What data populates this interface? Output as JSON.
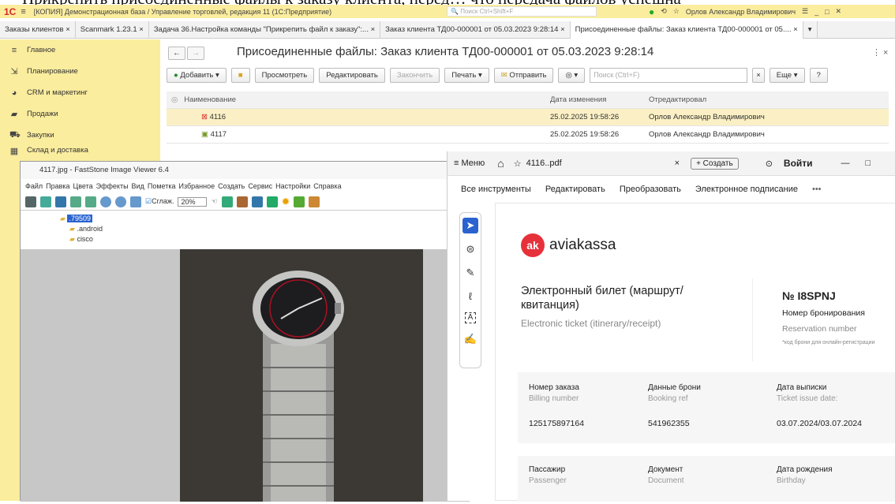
{
  "ghost_text": "Прикрепить присоединенные файлы к заказу клиента, перед… что передача файлов успешна",
  "titlebar": {
    "logo": "1С",
    "title": "[КОПИЯ] Демонстрационная база / Управление торговлей, редакция 11  (1С:Предприятие)",
    "search_placeholder": "Поиск Ctrl+Shift+F",
    "user": "Орлов Александр Владимирович"
  },
  "tabs": [
    {
      "label": "Заказы клиентов ×"
    },
    {
      "label": "Scanmark 1.23.1 ×"
    },
    {
      "label": "Задача 36.Настройка команды \"Прикрепить файл к заказу\":... ×"
    },
    {
      "label": "Заказ клиента ТД00-000001 от 05.03.2023 9:28:14 ×"
    },
    {
      "label": "Присоединенные файлы: Заказ клиента ТД00-000001 от 05.... ×"
    }
  ],
  "sidebar": {
    "items": [
      {
        "label": "Главное",
        "icon": "menu-icon"
      },
      {
        "label": "Планирование",
        "icon": "chart-icon"
      },
      {
        "label": "CRM и маркетинг",
        "icon": "pie-icon"
      },
      {
        "label": "Продажи",
        "icon": "bag-icon"
      },
      {
        "label": "Закупки",
        "icon": "cart-icon"
      },
      {
        "label": "Склад и доставка",
        "icon": "grid-icon"
      }
    ]
  },
  "main": {
    "title": "Присоединенные файлы: Заказ клиента ТД00-000001 от 05.03.2023 9:28:14",
    "toolbar": {
      "add": "Добавить",
      "view": "Просмотреть",
      "edit": "Редактировать",
      "finish": "Закончить",
      "print": "Печать",
      "send": "Отправить",
      "search_placeholder": "Поиск (Ctrl+F)",
      "more": "Еще",
      "help": "?"
    },
    "columns": [
      "Наименование",
      "Дата изменения",
      "Отредактировал"
    ],
    "rows": [
      {
        "name": "4116",
        "date": "25.02.2025 19:58:26",
        "editor": "Орлов Александр Владимирович"
      },
      {
        "name": "4117",
        "date": "25.02.2025 19:58:26",
        "editor": "Орлов Александр Владимирович"
      }
    ]
  },
  "faststone": {
    "title": "4117.jpg  -  FastStone Image Viewer 6.4",
    "menu": [
      "Файл",
      "Правка",
      "Цвета",
      "Эффекты",
      "Вид",
      "Пометка",
      "Избранное",
      "Создать",
      "Сервис",
      "Настройки",
      "Справка"
    ],
    "smooth_label": "Сглаж.",
    "zoom": "20%",
    "tree": [
      ".79509",
      ".android",
      "cisco"
    ]
  },
  "pdf": {
    "menu_label": "Меню",
    "tab_title": "4116..pdf",
    "create_label": "+ Создать",
    "login_label": "Войти",
    "tools": [
      "Все инструменты",
      "Редактировать",
      "Преобразовать",
      "Электронное подписание",
      "•••"
    ],
    "doc": {
      "brand": "aviakassa",
      "heading_ru": "Электронный билет (маршрут/ квитанция)",
      "heading_en": "Electronic ticket (itinerary/receipt)",
      "booking_no": "№ I8SPNJ",
      "booking_ru": "Номер бронирования",
      "booking_en": "Reservation number",
      "booking_note": "*код брони для онлайн-регистрации",
      "card1": [
        {
          "label": "Номер заказа",
          "sub": "Billing number",
          "value": "125175897164"
        },
        {
          "label": "Данные брони",
          "sub": "Booking ref",
          "value": "541962355"
        },
        {
          "label": "Дата выписки",
          "sub": "Ticket issue date:",
          "value": "03.07.2024/03.07.2024"
        }
      ],
      "card2": [
        {
          "label": "Пассажир",
          "sub": "Passenger"
        },
        {
          "label": "Документ",
          "sub": "Document"
        },
        {
          "label": "Дата рождения",
          "sub": "Birthday"
        }
      ]
    }
  },
  "colors": {
    "accent_yellow": "#fbed9e",
    "selection": "#fbf0c5",
    "brand_red": "#e6313b",
    "pdf_blue": "#2a63d0"
  }
}
